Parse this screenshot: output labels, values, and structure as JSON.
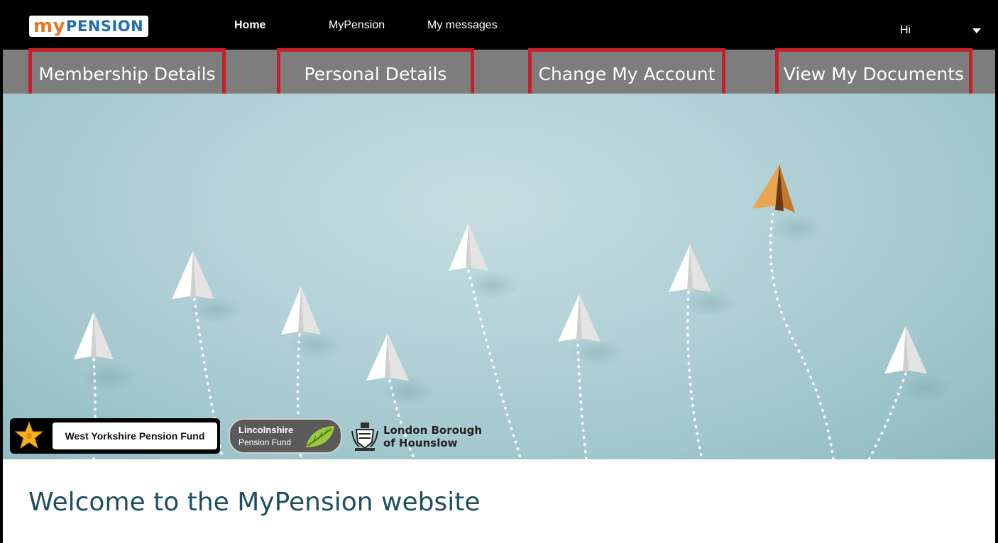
{
  "header": {
    "logo": {
      "my": "my",
      "pension": "PENSION"
    },
    "nav": [
      {
        "label": "Home",
        "active": true
      },
      {
        "label": "MyPension",
        "active": false
      },
      {
        "label": "My messages",
        "active": false
      }
    ],
    "greeting": "Hi"
  },
  "subnav": {
    "items": [
      {
        "label": "Membership Details",
        "highlighted": true
      },
      {
        "label": "Personal Details",
        "highlighted": true
      },
      {
        "label": "Change My Account",
        "highlighted": true
      },
      {
        "label": "View My Documents",
        "highlighted": true
      }
    ],
    "highlight_color": "#c8202a"
  },
  "hero": {
    "partners": {
      "west_yorkshire": "West Yorkshire Pension Fund",
      "lincolnshire_line1": "Lincolnshire",
      "lincolnshire_line2": "Pension Fund",
      "hounslow_line1": "London Borough",
      "hounslow_line2": "of Hounslow"
    }
  },
  "main": {
    "welcome_title": "Welcome to the MyPension website"
  },
  "colors": {
    "topbar": "#000000",
    "subnav": "#7d7d7d",
    "hero_background": "#b5d3d8",
    "welcome_text": "#1f4e60",
    "logo_my": "#e87722",
    "logo_pension": "#1f6fb2"
  }
}
